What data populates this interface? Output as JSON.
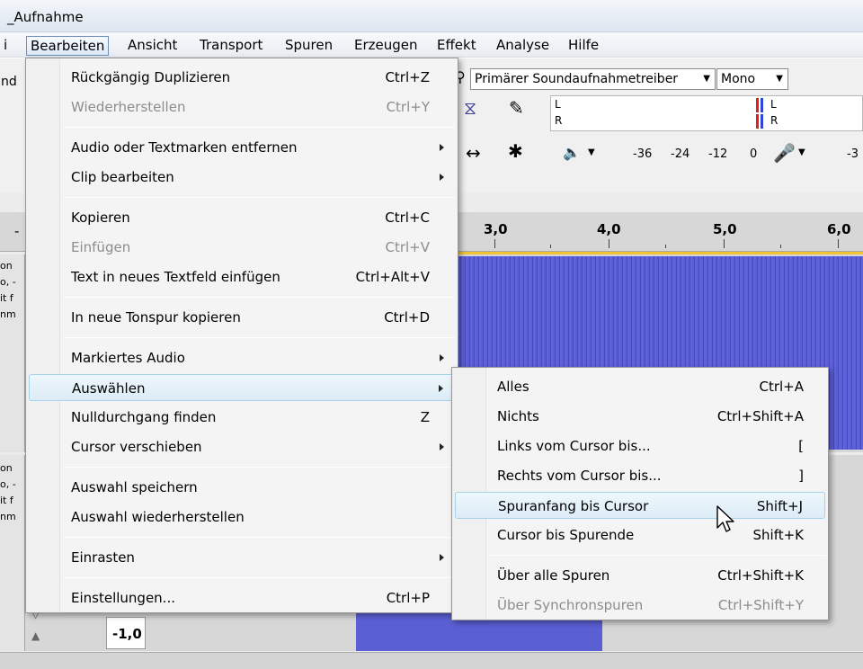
{
  "window": {
    "title": "_Aufnahme"
  },
  "menubar": {
    "items": [
      "i",
      "Bearbeiten",
      "Ansicht",
      "Transport",
      "Spuren",
      "Erzeugen",
      "Effekt",
      "Analyse",
      "Hilfe"
    ],
    "active": "Bearbeiten"
  },
  "toolbar": {
    "left_fragment": "nd",
    "recording_device": "Primärer Soundaufnahmetreiber",
    "channels": "Mono",
    "meter_left": "L",
    "meter_right": "R",
    "scale": [
      "-36",
      "-24",
      "-12",
      "0"
    ],
    "scale_cut": "-3"
  },
  "ruler": {
    "ticks": [
      "3,0",
      "4,0",
      "5,0",
      "6,0"
    ],
    "left_mark": "-"
  },
  "tracks": {
    "label_fragments": [
      "on",
      "o, -",
      "it f",
      "nm"
    ],
    "label_fragments_2": [
      "on",
      "o, -",
      "it f",
      "nm"
    ],
    "zoom_value": "-1,0"
  },
  "edit_menu": {
    "groups": [
      [
        {
          "label": "Rückgängig Duplizieren",
          "shortcut": "Ctrl+Z",
          "disabled": false,
          "submenu": false
        },
        {
          "label": "Wiederherstellen",
          "shortcut": "Ctrl+Y",
          "disabled": true,
          "submenu": false
        }
      ],
      [
        {
          "label": "Audio oder Textmarken entfernen",
          "shortcut": "",
          "disabled": false,
          "submenu": true
        },
        {
          "label": "Clip bearbeiten",
          "shortcut": "",
          "disabled": false,
          "submenu": true
        }
      ],
      [
        {
          "label": "Kopieren",
          "shortcut": "Ctrl+C",
          "disabled": false,
          "submenu": false
        },
        {
          "label": "Einfügen",
          "shortcut": "Ctrl+V",
          "disabled": true,
          "submenu": false
        },
        {
          "label": "Text in neues Textfeld einfügen",
          "shortcut": "Ctrl+Alt+V",
          "disabled": false,
          "submenu": false
        }
      ],
      [
        {
          "label": "In neue Tonspur kopieren",
          "shortcut": "Ctrl+D",
          "disabled": false,
          "submenu": false
        }
      ],
      [
        {
          "label": "Markiertes Audio",
          "shortcut": "",
          "disabled": false,
          "submenu": true
        },
        {
          "label": "Auswählen",
          "shortcut": "",
          "disabled": false,
          "submenu": true,
          "highlight": true
        },
        {
          "label": "Nulldurchgang finden",
          "shortcut": "Z",
          "disabled": false,
          "submenu": false
        },
        {
          "label": "Cursor verschieben",
          "shortcut": "",
          "disabled": false,
          "submenu": true
        }
      ],
      [
        {
          "label": "Auswahl speichern",
          "shortcut": "",
          "disabled": false,
          "submenu": false
        },
        {
          "label": "Auswahl wiederherstellen",
          "shortcut": "",
          "disabled": false,
          "submenu": false
        }
      ],
      [
        {
          "label": "Einrasten",
          "shortcut": "",
          "disabled": false,
          "submenu": true
        }
      ],
      [
        {
          "label": "Einstellungen...",
          "shortcut": "Ctrl+P",
          "disabled": false,
          "submenu": false
        }
      ]
    ]
  },
  "select_submenu": {
    "groups": [
      [
        {
          "label": "Alles",
          "shortcut": "Ctrl+A",
          "disabled": false
        },
        {
          "label": "Nichts",
          "shortcut": "Ctrl+Shift+A",
          "disabled": false
        },
        {
          "label": "Links vom Cursor bis...",
          "shortcut": "[",
          "disabled": false
        },
        {
          "label": "Rechts vom Cursor bis...",
          "shortcut": "]",
          "disabled": false
        },
        {
          "label": "Spuranfang bis Cursor",
          "shortcut": "Shift+J",
          "disabled": false,
          "highlight": true
        },
        {
          "label": "Cursor bis Spurende",
          "shortcut": "Shift+K",
          "disabled": false
        }
      ],
      [
        {
          "label": "Über alle Spuren",
          "shortcut": "Ctrl+Shift+K",
          "disabled": false
        },
        {
          "label": "Über Synchronspuren",
          "shortcut": "Ctrl+Shift+Y",
          "disabled": true
        }
      ]
    ]
  },
  "icons": [
    "pointer-cursor-icon",
    "submenu-arrow-icon",
    "pencil-icon",
    "envelope-tool-icon",
    "timeshift-icon",
    "multi-tool-icon",
    "speaker-icon",
    "microphone-icon"
  ],
  "colors": {
    "waveform": "#6465d8",
    "highlight": "#dcecf6",
    "cursor_line": "#f1c232"
  }
}
